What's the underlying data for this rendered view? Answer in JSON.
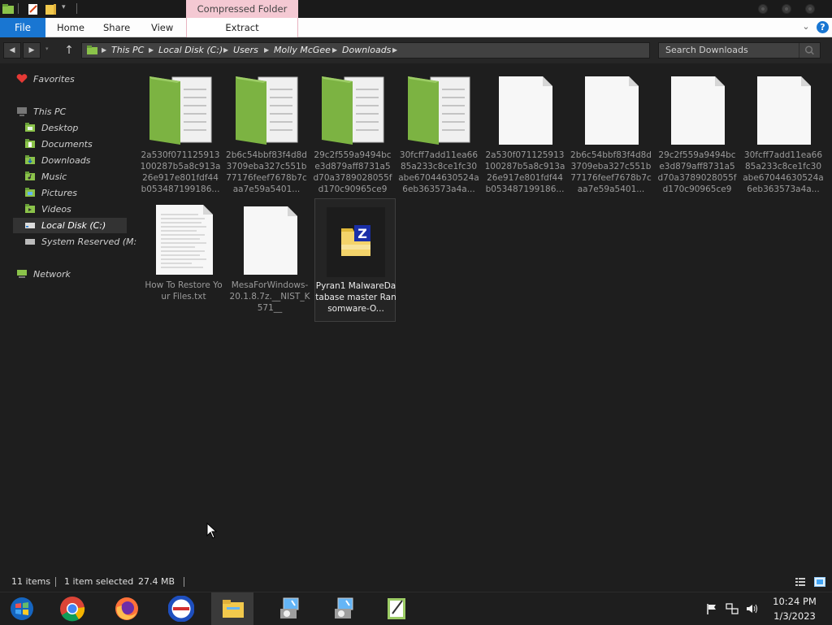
{
  "titlebar": {
    "contextual_tab_label": "Compressed Folder Tools"
  },
  "ribbon": {
    "tabs": [
      {
        "label": "File"
      },
      {
        "label": "Home"
      },
      {
        "label": "Share"
      },
      {
        "label": "View"
      },
      {
        "label": "Extract"
      }
    ],
    "help_label": "?"
  },
  "navbar": {
    "breadcrumb": [
      "This PC",
      "Local Disk (C:)",
      "Users",
      "Molly McGee",
      "Downloads"
    ],
    "search_placeholder": "Search Downloads"
  },
  "sidebar": {
    "favorites": "Favorites",
    "this_pc": "This PC",
    "items": [
      {
        "label": "Desktop",
        "icon": "desktop-icon"
      },
      {
        "label": "Documents",
        "icon": "documents-icon"
      },
      {
        "label": "Downloads",
        "icon": "downloads-icon"
      },
      {
        "label": "Music",
        "icon": "music-icon"
      },
      {
        "label": "Pictures",
        "icon": "pictures-icon"
      },
      {
        "label": "Videos",
        "icon": "videos-icon"
      },
      {
        "label": "Local Disk (C:)",
        "icon": "drive-icon"
      },
      {
        "label": "System Reserved (M:",
        "icon": "drive-icon"
      }
    ],
    "network": "Network"
  },
  "files": [
    {
      "name": "2a530f071125913100287b5a8c913a26e917e801fdf44b053487199186...",
      "kind": "zip-folder"
    },
    {
      "name": "2b6c54bbf83f4d8d3709eba327c551b77176feef7678b7caa7e59a5401...",
      "kind": "zip-folder"
    },
    {
      "name": "29c2f559a9494bce3d879aff8731a5d70a3789028055fd170c90965ce9c...",
      "kind": "zip-folder"
    },
    {
      "name": "30fcff7add11ea6685a233c8ce1fc30abe67044630524a6eb363573a4a...",
      "kind": "zip-folder"
    },
    {
      "name": "2a530f071125913100287b5a8c913a26e917e801fdf44b053487199186...",
      "kind": "blank-file"
    },
    {
      "name": "2b6c54bbf83f4d8d3709eba327c551b77176feef7678b7caa7e59a5401...",
      "kind": "blank-file"
    },
    {
      "name": "29c2f559a9494bce3d879aff8731a5d70a3789028055fd170c90965ce9c...",
      "kind": "blank-file"
    },
    {
      "name": "30fcff7add11ea6685a233c8ce1fc30abe67044630524a6eb363573a4a...",
      "kind": "blank-file"
    },
    {
      "name": "How To Restore Your Files.txt",
      "kind": "text-file"
    },
    {
      "name": "MesaForWindows-20.1.8.7z.__NIST_K571__",
      "kind": "blank-file"
    },
    {
      "name": "Pyran1 MalwareDatabase master Ransomware-O...",
      "kind": "7z-archive"
    }
  ],
  "status": {
    "item_count": "11 items",
    "selection": "1 item selected",
    "size": "27.4 MB"
  },
  "taskbar": {
    "apps": [
      "start-icon",
      "chrome-icon",
      "firefox-icon",
      "opera-icon",
      "file-explorer-icon",
      "installer-icon",
      "installer-icon",
      "notepad-icon"
    ],
    "time": "10:24 PM",
    "date": "1/3/2023"
  },
  "colors": {
    "accent": "#1976d2",
    "contextual_tab": "#f4c9d3",
    "zip_green": "#7cb342",
    "background": "#1e1e1e"
  }
}
